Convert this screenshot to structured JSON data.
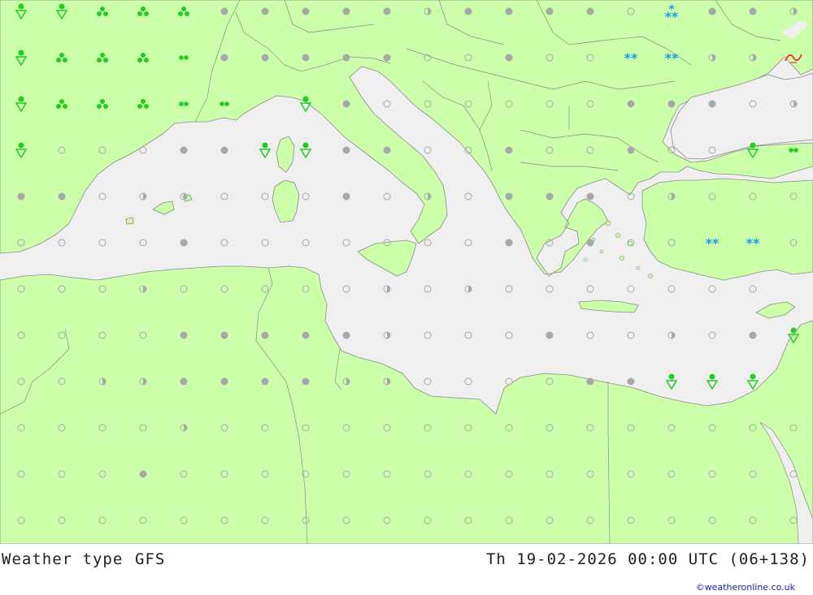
{
  "title": "Weather type",
  "model": "GFS",
  "datetime": "Th 19-02-2026 00:00 UTC (06+138)",
  "credit": "©weatheronline.co.uk",
  "colors": {
    "land": "#ccffaa",
    "sea": "#efefef",
    "border": "#8a8a8a",
    "dot_gray": "#a8a8a8",
    "rain_green": "#22cc22",
    "snow_blue": "#1a9ee8",
    "fog_red": "#e83030"
  },
  "symbol_legend": {
    "o": "clear-icon",
    "h": "partly-cloudy-icon",
    "c": "cloudy-icon",
    "s": "rain-shower-icon",
    "r": "rain-icon",
    "d": "drizzle-icon",
    "n": "snow-icon",
    "N": "snow-shower-icon",
    "f": "fog-icon",
    "_": "none"
  },
  "symbol_grid": {
    "columns": 20,
    "rows": 12,
    "cells": [
      "ssrrrccccchccccoNcchN",
      "srrrdcccccoocoonnhhf",
      "srrrdd_scoooooocccohc",
      "soooccssccoocoocoosd",
      "ccohhooocohocccohooo",
      "oooocooooooococoonno",
      "ooohooooohohooooooo",
      "ooooccccchooocoohocs",
      "oohhcccchhooooccsss",
      "oooohooooooooooooooo",
      "ooocooooooooooooooooo",
      "oooooooooooooooooooo"
    ]
  }
}
